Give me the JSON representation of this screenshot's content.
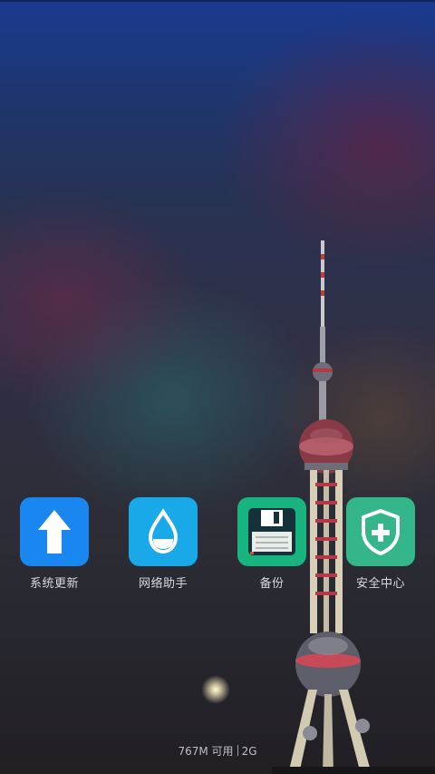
{
  "apps": [
    {
      "label": "系统更新",
      "icon": "arrow-up-icon",
      "color": "#1a87f0"
    },
    {
      "label": "网络助手",
      "icon": "water-drop-icon",
      "color": "#19a9e9"
    },
    {
      "label": "备份",
      "icon": "floppy-disk-icon",
      "color": "#17b47f"
    },
    {
      "label": "安全中心",
      "icon": "shield-plus-icon",
      "color": "#35b68a"
    }
  ],
  "footer": {
    "memory": "767M 可用",
    "network": "2G"
  }
}
